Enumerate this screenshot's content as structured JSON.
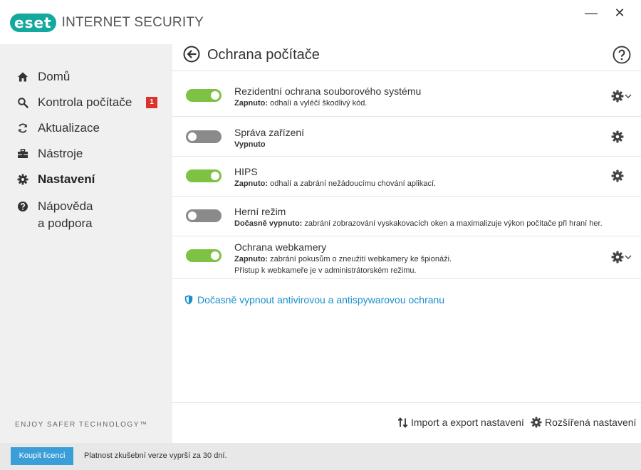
{
  "app": {
    "logo_text": "eset",
    "product_name": "INTERNET SECURITY",
    "window_controls": {
      "minimize": "—",
      "close": "✕"
    }
  },
  "sidebar": {
    "items": [
      {
        "label": "Domů",
        "icon": "home-icon"
      },
      {
        "label": "Kontrola počítače",
        "icon": "search-icon",
        "badge": "1"
      },
      {
        "label": "Aktualizace",
        "icon": "refresh-icon"
      },
      {
        "label": "Nástroje",
        "icon": "toolbox-icon"
      },
      {
        "label": "Nastavení",
        "icon": "gear-icon",
        "active": true
      },
      {
        "label_line1": "Nápověda",
        "label_line2": "a podpora",
        "icon": "help-icon"
      }
    ],
    "tagline": "ENJOY SAFER TECHNOLOGY™"
  },
  "main": {
    "title": "Ochrana počítače",
    "rows": [
      {
        "title": "Rezidentní ochrana souborového systému",
        "status": "Zapnuto:",
        "desc": "odhalí a vyléčí škodlivý kód.",
        "enabled": true
      },
      {
        "title": "Správa zařízení",
        "status": "Vypnuto",
        "desc": "",
        "enabled": false
      },
      {
        "title": "HIPS",
        "status": "Zapnuto:",
        "desc": "odhalí a zabrání nežádoucímu chování aplikací.",
        "enabled": true
      },
      {
        "title": "Herní režim",
        "status": "Dočasně vypnuto:",
        "desc": "zabrání zobrazování vyskakovacích oken a maximalizuje výkon počítače při hraní her.",
        "enabled": false
      },
      {
        "title": "Ochrana webkamery",
        "status": "Zapnuto:",
        "desc": "zabrání pokusům o zneužití webkamery ke špionáži.",
        "desc2": "Přístup k webkameře je v administrátorském režimu.",
        "enabled": true
      }
    ],
    "pause_link": "Dočasně vypnout antivirovou a antispywarovou ochranu",
    "footer": {
      "import_export": "Import a export nastavení",
      "advanced": "Rozšířená nastavení"
    }
  },
  "statusbar": {
    "buy_button": "Koupit licenci",
    "trial_text": "Platnost zkušební verze vyprší za 30 dní."
  },
  "colors": {
    "accent": "#14a99e",
    "toggle_on": "#7dc242",
    "toggle_off": "#8a8a8a",
    "link": "#1b8fc9",
    "badge": "#d9332b",
    "button": "#3a9ed8"
  }
}
